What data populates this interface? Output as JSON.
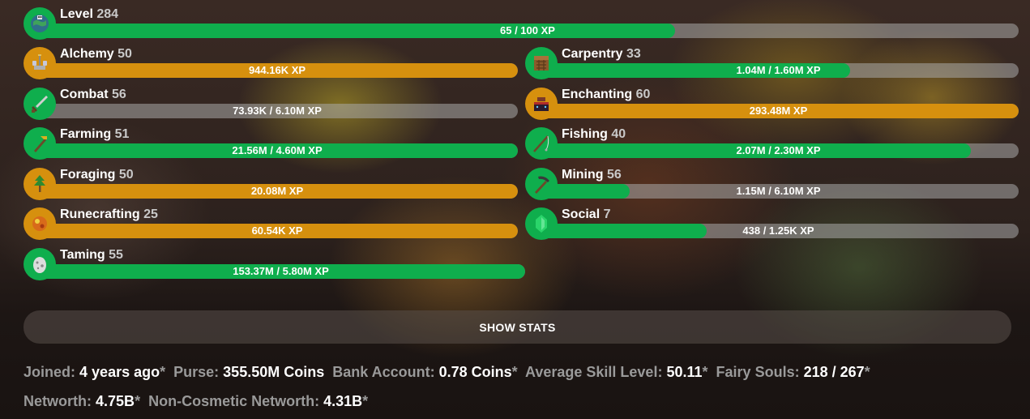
{
  "skills": {
    "level": {
      "name": "Level",
      "level": "284",
      "xp": "65 / 100 XP",
      "progress": 0.65,
      "color": "green",
      "icon": "globe-icon"
    },
    "alchemy": {
      "name": "Alchemy",
      "level": "50",
      "xp": "944.16K XP",
      "progress": 1.0,
      "color": "gold",
      "icon": "brewing-stand-icon"
    },
    "carpentry": {
      "name": "Carpentry",
      "level": "33",
      "xp": "1.04M / 1.60M XP",
      "progress": 0.65,
      "color": "green",
      "icon": "crafting-table-icon"
    },
    "combat": {
      "name": "Combat",
      "level": "56",
      "xp": "73.93K / 6.10M XP",
      "progress": 0.01,
      "color": "green",
      "icon": "sword-icon"
    },
    "enchanting": {
      "name": "Enchanting",
      "level": "60",
      "xp": "293.48M XP",
      "progress": 1.0,
      "color": "gold",
      "icon": "enchanting-table-icon"
    },
    "farming": {
      "name": "Farming",
      "level": "51",
      "xp": "21.56M / 4.60M XP",
      "progress": 1.0,
      "color": "green",
      "icon": "hoe-icon"
    },
    "fishing": {
      "name": "Fishing",
      "level": "40",
      "xp": "2.07M / 2.30M XP",
      "progress": 0.9,
      "color": "green",
      "icon": "fishing-rod-icon"
    },
    "foraging": {
      "name": "Foraging",
      "level": "50",
      "xp": "20.08M XP",
      "progress": 1.0,
      "color": "gold",
      "icon": "sapling-icon"
    },
    "mining": {
      "name": "Mining",
      "level": "56",
      "xp": "1.15M / 6.10M XP",
      "progress": 0.19,
      "color": "green",
      "icon": "pickaxe-icon"
    },
    "runecrafting": {
      "name": "Runecrafting",
      "level": "25",
      "xp": "60.54K XP",
      "progress": 1.0,
      "color": "gold",
      "icon": "magma-cream-icon"
    },
    "social": {
      "name": "Social",
      "level": "7",
      "xp": "438 / 1.25K XP",
      "progress": 0.35,
      "color": "green",
      "icon": "emerald-icon"
    },
    "taming": {
      "name": "Taming",
      "level": "55",
      "xp": "153.37M / 5.80M XP",
      "progress": 1.0,
      "color": "green",
      "icon": "spawn-egg-icon"
    }
  },
  "show_stats_label": "SHOW STATS",
  "stats": {
    "joined_label": "Joined:",
    "joined_value": "4 years ago",
    "purse_label": "Purse:",
    "purse_value": "355.50M Coins",
    "bank_label": "Bank Account:",
    "bank_value": "0.78 Coins",
    "avg_skill_label": "Average Skill Level:",
    "avg_skill_value": "50.11",
    "fairy_label": "Fairy Souls:",
    "fairy_value": "218 / 267",
    "networth_label": "Networth:",
    "networth_value": "4.75B",
    "noncos_label": "Non-Cosmetic Networth:",
    "noncos_value": "4.31B",
    "asterisk": "*"
  },
  "colors": {
    "green": "#0fae4d",
    "gold": "#d6900e",
    "track": "#8a8a8a"
  }
}
